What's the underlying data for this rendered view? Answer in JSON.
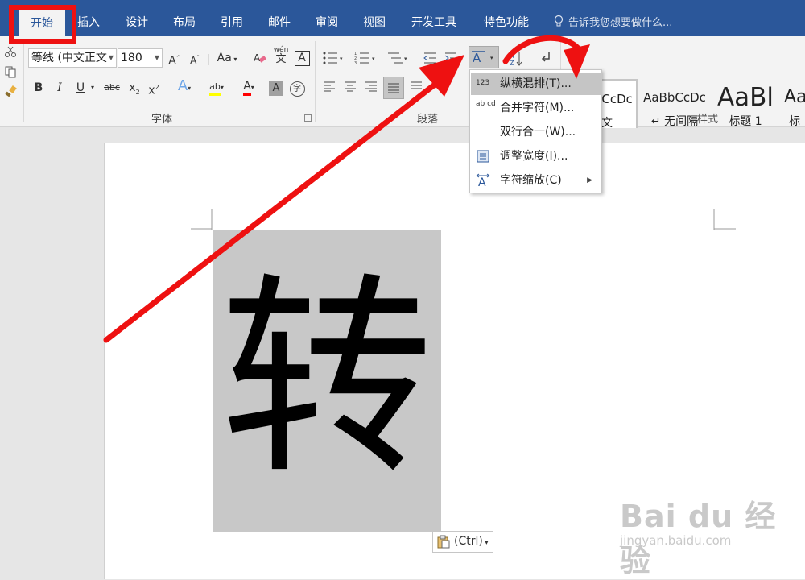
{
  "ribbon": {
    "tabs": [
      {
        "label": "开始",
        "active": true
      },
      {
        "label": "插入"
      },
      {
        "label": "设计"
      },
      {
        "label": "布局"
      },
      {
        "label": "引用"
      },
      {
        "label": "邮件"
      },
      {
        "label": "审阅"
      },
      {
        "label": "视图"
      },
      {
        "label": "开发工具"
      },
      {
        "label": "特色功能"
      }
    ],
    "tell_me": "告诉我您想要做什么...",
    "font": {
      "name": "等线 (中文正文",
      "size": "180",
      "grow": "A",
      "shrink": "A",
      "change_case": "Aa",
      "phonetic_top": "wén",
      "phonetic_bottom": "文",
      "char_border": "A",
      "bold": "B",
      "italic": "I",
      "underline": "U",
      "strikethrough": "abc",
      "subscript_base": "x",
      "subscript_mark": "2",
      "superscript_base": "x",
      "superscript_mark": "2",
      "text_effects": "A",
      "highlight": "ab",
      "font_color": "A",
      "char_shading": "A",
      "enclose": "字",
      "group_label": "字体"
    },
    "paragraph": {
      "group_label": "段落"
    },
    "styles": {
      "group_label": "样式",
      "items": [
        {
          "sample": "AaBbCcDc",
          "name": "正文"
        },
        {
          "sample": "AaBbCcDc",
          "name": "↵ 无间隔"
        },
        {
          "sample": "AaBl",
          "name": "标题 1"
        },
        {
          "sample": "Aa",
          "name": "标"
        }
      ]
    }
  },
  "menu": {
    "items": [
      {
        "icon": "123",
        "label": "纵横混排(T)...",
        "highlighted": true
      },
      {
        "icon": "ab cd",
        "label": "合并字符(M)..."
      },
      {
        "icon": "",
        "label": "双行合一(W)..."
      },
      {
        "icon": "adjust-width",
        "label": "调整宽度(I)..."
      },
      {
        "icon": "char-scale",
        "label": "字符缩放(C)",
        "has_submenu": true
      }
    ]
  },
  "document": {
    "character": "转",
    "paste_options": "(Ctrl)"
  },
  "watermark": {
    "logo": "Bai du 经验",
    "url": "jingyan.baidu.com"
  },
  "colors": {
    "ribbon_blue": "#2b579a",
    "annotation_red": "#ee1111",
    "highlight_yellow": "#ffff00",
    "font_color_red": "#ff0000"
  }
}
